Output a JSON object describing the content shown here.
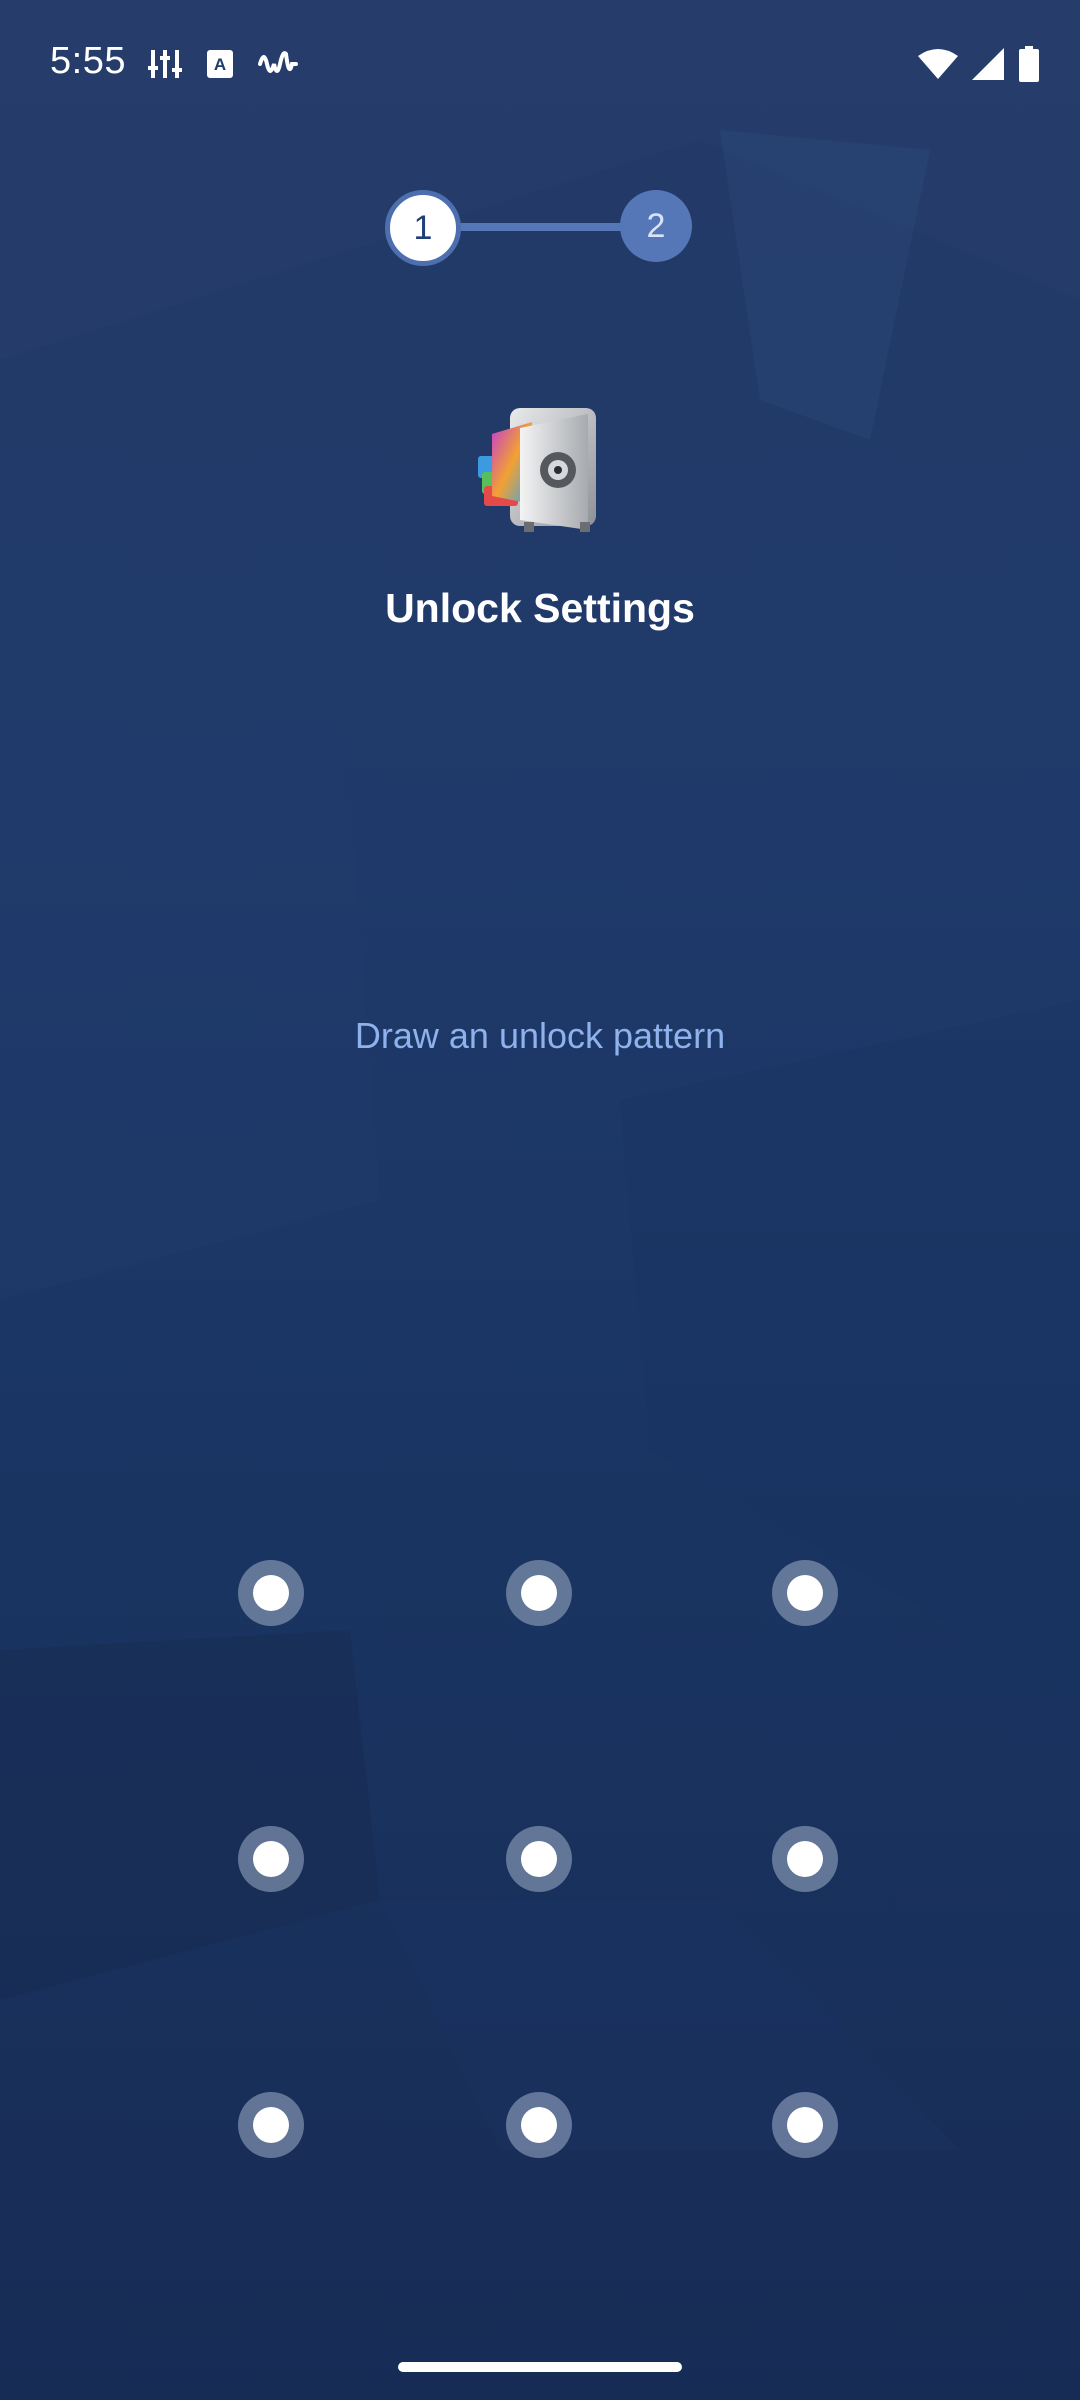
{
  "status_bar": {
    "time": "5:55",
    "left_icons": [
      "equalizer-icon",
      "text-a-icon",
      "waveform-icon"
    ],
    "right_icons": [
      "wifi-icon",
      "signal-icon",
      "battery-icon"
    ]
  },
  "stepper": {
    "steps": [
      {
        "label": "1",
        "state": "active"
      },
      {
        "label": "2",
        "state": "inactive"
      }
    ]
  },
  "header": {
    "icon": "app-lock-safe-icon",
    "title": "Unlock Settings"
  },
  "pattern": {
    "hint": "Draw an unlock pattern",
    "dots": 9
  },
  "colors": {
    "background": "#1f3a6a",
    "accent": "#5577b7",
    "hint_text": "#8fb2ec"
  }
}
